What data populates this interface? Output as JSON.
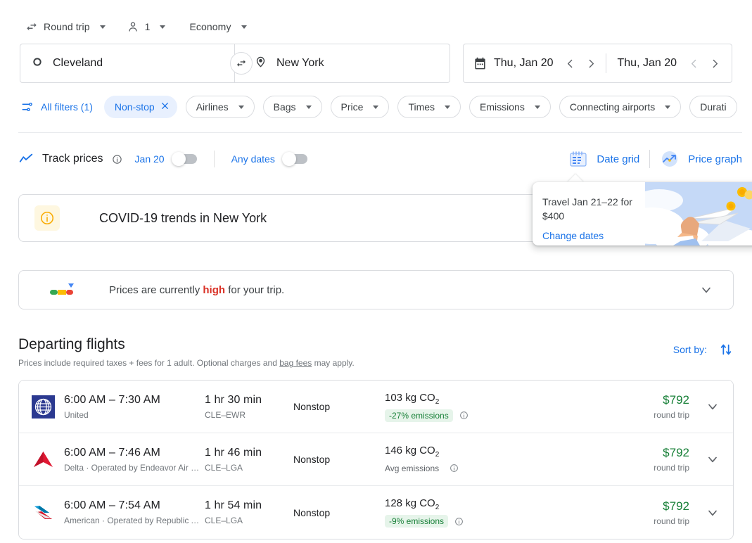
{
  "options": {
    "trip_type": "Round trip",
    "passengers": "1",
    "cabin": "Economy"
  },
  "search": {
    "origin": "Cleveland",
    "destination": "New York",
    "depart_date": "Thu, Jan 20",
    "return_date": "Thu, Jan 20"
  },
  "filters": {
    "all_filters": "All filters (1)",
    "chips": [
      {
        "label": "Non-stop",
        "active": true
      },
      {
        "label": "Airlines",
        "active": false
      },
      {
        "label": "Bags",
        "active": false
      },
      {
        "label": "Price",
        "active": false
      },
      {
        "label": "Times",
        "active": false
      },
      {
        "label": "Emissions",
        "active": false
      },
      {
        "label": "Connecting airports",
        "active": false
      },
      {
        "label": "Durati",
        "active": false
      }
    ]
  },
  "tracking": {
    "track_prices_label": "Track prices",
    "date_label": "Jan 20",
    "any_dates_label": "Any dates",
    "date_grid_label": "Date grid",
    "price_graph_label": "Price graph"
  },
  "tooltip": {
    "line1": "Travel Jan 21–22 for",
    "line2": "$400",
    "link": "Change dates"
  },
  "covid": {
    "title": "COVID-19 trends in New York"
  },
  "price_insight": {
    "text_before": "Prices are currently ",
    "highlight": "high",
    "text_after": " for your trip."
  },
  "departing": {
    "title": "Departing flights",
    "subtitle_before": "Prices include required taxes + fees for 1 adult. Optional charges and ",
    "subtitle_link": "bag fees",
    "subtitle_after": " may apply.",
    "sort_by_label": "Sort by:"
  },
  "flights": [
    {
      "logo": "united",
      "times": "6:00 AM – 7:30 AM",
      "airline": "United",
      "duration": "1 hr 30 min",
      "route": "CLE–EWR",
      "stops": "Nonstop",
      "co2": "103 kg CO",
      "co2_sub": "2",
      "emissions_badge": "-27% emissions",
      "emissions_style": "green",
      "price": "$792",
      "price_sub": "round trip"
    },
    {
      "logo": "delta",
      "times": "6:00 AM – 7:46 AM",
      "airline": "Delta · Operated by Endeavor Air DBA Delta Conne…",
      "duration": "1 hr 46 min",
      "route": "CLE–LGA",
      "stops": "Nonstop",
      "co2": "146 kg CO",
      "co2_sub": "2",
      "emissions_badge": "Avg emissions",
      "emissions_style": "plain",
      "price": "$792",
      "price_sub": "round trip"
    },
    {
      "logo": "american",
      "times": "6:00 AM – 7:54 AM",
      "airline": "American · Operated by Republic Airways as Ame…",
      "duration": "1 hr 54 min",
      "route": "CLE–LGA",
      "stops": "Nonstop",
      "co2": "128 kg CO",
      "co2_sub": "2",
      "emissions_badge": "-9% emissions",
      "emissions_style": "green",
      "price": "$792",
      "price_sub": "round trip"
    }
  ],
  "colors": {
    "blue": "#1a73e8",
    "green": "#188038",
    "red": "#d93025",
    "chip_active_bg": "#e8f0fe",
    "badge_bg": "#e6f4ea"
  }
}
